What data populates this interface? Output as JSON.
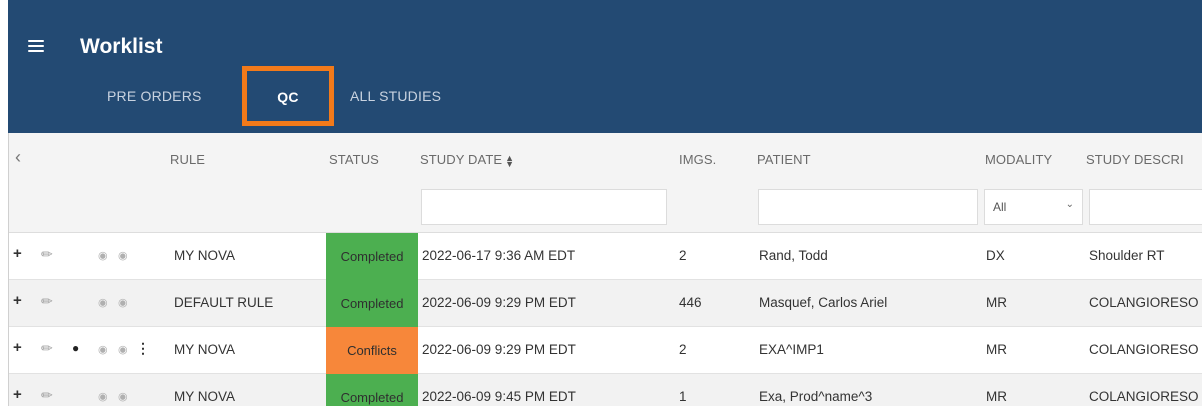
{
  "header": {
    "title": "Worklist",
    "tabs": [
      "PRE ORDERS",
      "QC",
      "ALL STUDIES"
    ],
    "active_tab": "QC",
    "highlight_color": "#f27a1a",
    "background_color": "#234a73"
  },
  "table": {
    "columns": [
      "RULE",
      "STATUS",
      "STUDY DATE",
      "IMGS.",
      "PATIENT",
      "MODALITY",
      "STUDY DESCRI"
    ],
    "filters": {
      "modality": "All"
    },
    "rows": [
      {
        "rule": "MY NOVA",
        "status": "Completed",
        "status_color": "#4caf50",
        "study_date": "2022-06-17 9:36 AM EDT",
        "imgs": "2",
        "patient": "Rand, Todd",
        "modality": "DX",
        "description": "Shoulder RT",
        "dot": false,
        "kebab": false
      },
      {
        "rule": "DEFAULT RULE",
        "status": "Completed",
        "status_color": "#4caf50",
        "study_date": "2022-06-09 9:29 PM EDT",
        "imgs": "446",
        "patient": "Masquef, Carlos Ariel",
        "modality": "MR",
        "description": "COLANGIORESO",
        "dot": false,
        "kebab": false
      },
      {
        "rule": "MY NOVA",
        "status": "Conflicts",
        "status_color": "#f7873a",
        "study_date": "2022-06-09 9:29 PM EDT",
        "imgs": "2",
        "patient": "EXA^IMP1",
        "modality": "MR",
        "description": "COLANGIORESO",
        "dot": true,
        "kebab": true
      },
      {
        "rule": "MY NOVA",
        "status": "Completed",
        "status_color": "#4caf50",
        "study_date": "2022-06-09 9:45 PM EDT",
        "imgs": "1",
        "patient": "Exa, Prod^name^3",
        "modality": "MR",
        "description": "COLANGIORESO",
        "dot": false,
        "kebab": false
      }
    ]
  },
  "icons": {
    "collapse": "chevron-left-icon",
    "sort": "sort-icon",
    "add": "plus-icon",
    "edit": "pencil-icon",
    "flag": "dot-icon",
    "message": "message-icon",
    "view": "eye-icon",
    "more": "kebab-icon"
  }
}
